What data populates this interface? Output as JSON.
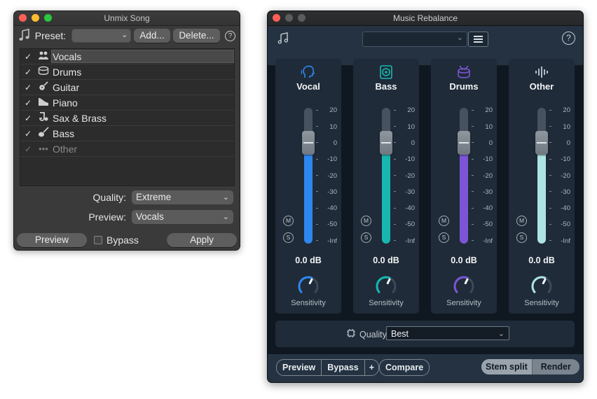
{
  "unmix": {
    "title": "Unmix Song",
    "preset_label": "Preset:",
    "preset_value": "",
    "add_label": "Add...",
    "delete_label": "Delete...",
    "help_label": "?",
    "stems": [
      {
        "label": "Vocals",
        "checked": true,
        "icon": "vocals-icon"
      },
      {
        "label": "Drums",
        "checked": true,
        "icon": "drums-icon"
      },
      {
        "label": "Guitar",
        "checked": true,
        "icon": "guitar-icon"
      },
      {
        "label": "Piano",
        "checked": true,
        "icon": "piano-icon"
      },
      {
        "label": "Sax & Brass",
        "checked": true,
        "icon": "sax-icon"
      },
      {
        "label": "Bass",
        "checked": true,
        "icon": "bass-icon"
      },
      {
        "label": "Other",
        "checked": true,
        "icon": "dots-icon"
      }
    ],
    "quality_label": "Quality:",
    "quality_value": "Extreme",
    "preview_label": "Preview:",
    "preview_value": "Vocals",
    "preview_button": "Preview",
    "bypass_label": "Bypass",
    "apply_label": "Apply"
  },
  "rebalance": {
    "title": "Music Rebalance",
    "help_label": "?",
    "scale_ticks": [
      "20",
      "10",
      "0",
      "-10",
      "-20",
      "-30",
      "-40",
      "-50",
      "-Inf"
    ],
    "mute_label": "M",
    "solo_label": "S",
    "channels": [
      {
        "name": "Vocal",
        "gain": "0.0 dB",
        "level_db": 0,
        "sensitivity_label": "Sensitivity",
        "sensitivity": 0.6,
        "color": "#2e86f0",
        "icon": "vocal-head-icon"
      },
      {
        "name": "Bass",
        "gain": "0.0 dB",
        "level_db": 0,
        "sensitivity_label": "Sensitivity",
        "sensitivity": 0.6,
        "color": "#17b7b0",
        "icon": "speaker-icon"
      },
      {
        "name": "Drums",
        "gain": "0.0 dB",
        "level_db": 0,
        "sensitivity_label": "Sensitivity",
        "sensitivity": 0.6,
        "color": "#7b55d6",
        "icon": "drum-icon"
      },
      {
        "name": "Other",
        "gain": "0.0 dB",
        "level_db": 0,
        "sensitivity_label": "Sensitivity",
        "sensitivity": 0.6,
        "color": "#aee3e3",
        "icon": "waveform-icon"
      }
    ],
    "quality_label": "Quality",
    "quality_value": "Best",
    "preview_button": "Preview",
    "bypass_button": "Bypass",
    "plus_button": "+",
    "compare_button": "Compare",
    "stem_split_button": "Stem split",
    "render_button": "Render"
  }
}
